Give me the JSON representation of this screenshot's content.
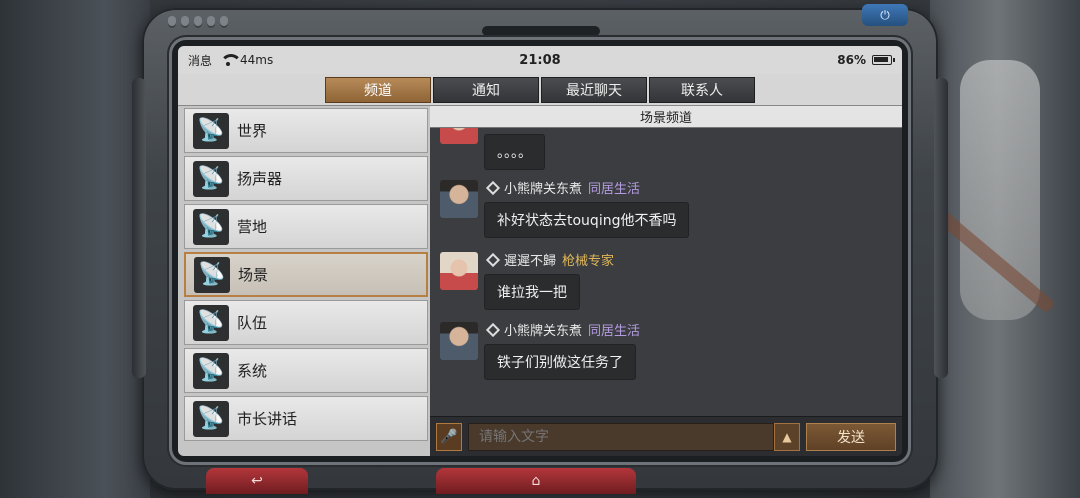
{
  "statusbar": {
    "carrier": "消息",
    "latency": "44ms",
    "time": "21:08",
    "battery": "86%"
  },
  "tabs": [
    {
      "label": "频道"
    },
    {
      "label": "通知"
    },
    {
      "label": "最近聊天"
    },
    {
      "label": "联系人"
    }
  ],
  "channels": [
    {
      "label": "世界"
    },
    {
      "label": "扬声器"
    },
    {
      "label": "营地"
    },
    {
      "label": "场景"
    },
    {
      "label": "队伍"
    },
    {
      "label": "系统"
    },
    {
      "label": "市长讲话"
    }
  ],
  "chat": {
    "title": "场景频道",
    "messages": [
      {
        "name": "",
        "tag": "",
        "text": "。。。。"
      },
      {
        "name": "小熊牌关东煮",
        "tag": "同居生活",
        "text": "补好状态去touqing他不香吗"
      },
      {
        "name": "遲遲不歸",
        "tag": "枪械专家",
        "text": "谁拉我一把"
      },
      {
        "name": "小熊牌关东煮",
        "tag": "同居生活",
        "text": "铁子们别做这任务了"
      }
    ]
  },
  "input": {
    "placeholder": "请输入文字",
    "send_label": "发送"
  },
  "icons": {
    "dish": "satellite-dish-icon",
    "mic": "microphone-icon",
    "expand": "expand-up-icon",
    "back": "back-arrow-icon",
    "home": "home-icon",
    "power": "power-icon"
  }
}
